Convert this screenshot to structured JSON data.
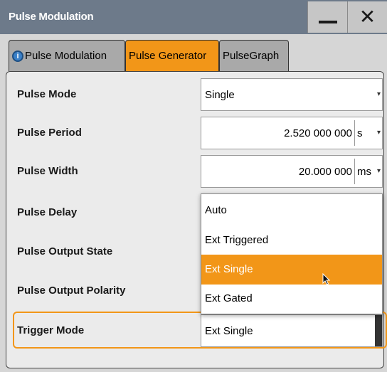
{
  "window": {
    "title": "Pulse Modulation",
    "minimize_symbol": "—",
    "close_symbol": "✕"
  },
  "tabs": [
    {
      "label": "Pulse Modulation",
      "icon": "info-icon",
      "active": false
    },
    {
      "label": "Pulse Generator",
      "active": true
    },
    {
      "label": "PulseGraph",
      "active": false
    }
  ],
  "rows": {
    "pulse_mode": {
      "label": "Pulse Mode",
      "value": "Single"
    },
    "pulse_period": {
      "label": "Pulse Period",
      "value": "2.520 000 000",
      "unit": "s"
    },
    "pulse_width": {
      "label": "Pulse Width",
      "value": "20.000 000",
      "unit": "ms"
    },
    "pulse_delay": {
      "label": "Pulse Delay"
    },
    "pulse_output_state": {
      "label": "Pulse Output State"
    },
    "pulse_output_polarity": {
      "label": "Pulse Output Polarity"
    },
    "trigger_mode": {
      "label": "Trigger Mode",
      "value": "Ext Single"
    }
  },
  "dropdown": {
    "options": [
      "Auto",
      "Ext Triggered",
      "Ext Single",
      "Ext Gated"
    ],
    "highlighted": "Ext Single"
  },
  "colors": {
    "accent": "#f29618",
    "titlebar": "#6d7a8a",
    "inactive_tab": "#a9a9a9"
  }
}
